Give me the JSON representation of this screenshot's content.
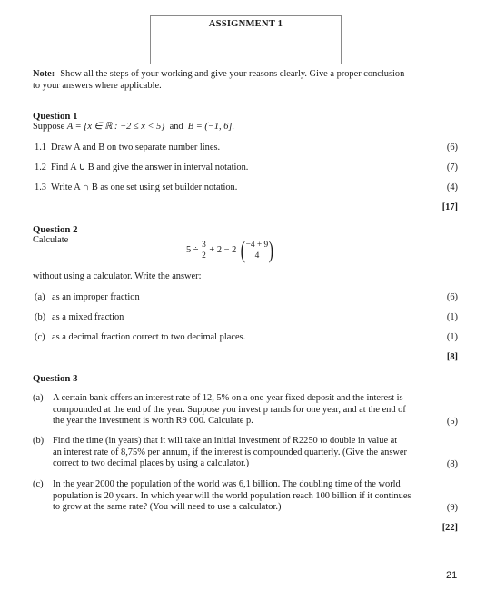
{
  "header": {
    "title": "ASSIGNMENT 1"
  },
  "note": {
    "label": "Note:",
    "line1": "Show all the steps of your working and give your reasons clearly.  Give a proper conclusion",
    "line2": "to your answers where applicable."
  },
  "q1": {
    "heading": "Question 1",
    "intro_pre": "Suppose",
    "setA": "A = {x ∈ ℝ : −2 ≤ x < 5}",
    "and": "and",
    "setB": "B = (−1, 6].",
    "items": [
      {
        "label": "1.1",
        "text": "Draw A and B on two separate number lines.",
        "marks": "(6)"
      },
      {
        "label": "1.2",
        "text": "Find A ∪ B and give the answer in interval notation.",
        "marks": "(7)"
      },
      {
        "label": "1.3",
        "text": "Write A ∩ B as one set using set builder notation.",
        "marks": "(4)"
      }
    ],
    "total": "[17]"
  },
  "q2": {
    "heading": "Question 2",
    "intro": "Calculate",
    "formula": {
      "a": "5 ÷",
      "frac1_num": "3",
      "frac1_den": "2",
      "b": "+ 2 − 2",
      "frac2_num": "−4 + 9",
      "frac2_den": "4"
    },
    "after": "without using a calculator. Write the answer:",
    "items": [
      {
        "label": "(a)",
        "text": "as an improper fraction",
        "marks": "(6)"
      },
      {
        "label": "(b)",
        "text": "as a mixed fraction",
        "marks": "(1)"
      },
      {
        "label": "(c)",
        "text": "as a decimal fraction correct to two decimal places.",
        "marks": "(1)"
      }
    ],
    "total": "[8]"
  },
  "q3": {
    "heading": "Question 3",
    "items": [
      {
        "label": "(a)",
        "lines": [
          "A certain bank offers an interest rate of 12, 5% on a one-year fixed deposit and the interest is",
          "compounded at the end of the year. Suppose you invest p rands for one year, and at the end of",
          "the year the investment is worth R9 000. Calculate p."
        ],
        "marks": "(5)"
      },
      {
        "label": "(b)",
        "lines": [
          "Find the time (in years) that it will take an initial investment of R2250 to double in value at",
          "an interest rate of 8,75% per annum, if the interest is compounded quarterly. (Give the answer",
          "correct to two decimal places by using a calculator.)"
        ],
        "marks": "(8)"
      },
      {
        "label": "(c)",
        "lines": [
          "In the year 2000 the population of the world was 6,1 billion.  The doubling time of the world",
          "population is 20 years. In which year will the world population reach 100 billion if it continues",
          "to grow at the same rate? (You will need to use a calculator.)"
        ],
        "marks": "(9)"
      }
    ],
    "total": "[22]"
  },
  "footer": {
    "page_number": "21"
  }
}
